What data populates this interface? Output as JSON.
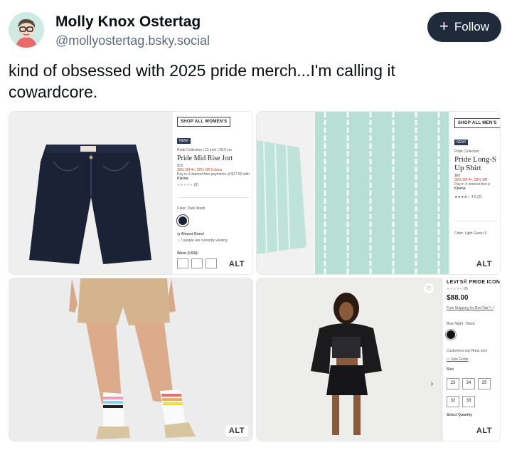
{
  "post": {
    "author_name": "Molly Knox Ostertag",
    "author_handle": "@mollyostertag.bsky.social",
    "follow_label": "Follow",
    "text": "kind of obsessed with 2025 pride merch...I'm calling it cowardcore."
  },
  "images": [
    {
      "alt_badge": "ALT",
      "shop_button": "SHOP ALL WOMEN'S",
      "badge": "NEW!",
      "collection": "Pride Collection | 12 inch | 30.5 cm",
      "title": "Pride Mid Rise Jort",
      "price": "$70",
      "promo": "30% Off 4+, 20% Off 3 items",
      "pay": "Pay in 4 interest-free payments of $17.50 with",
      "klarna": "Klarna",
      "reviews": "(0)",
      "color_label": "Color: Dark Wash",
      "almost_gone": "Almost Gone!",
      "viewing": "7 people are currently viewing",
      "waist": "Waist (USA):"
    },
    {
      "alt_badge": "ALT",
      "shop_button": "SHOP ALL MEN'S",
      "badge": "NEW!",
      "collection": "Pride Collection",
      "title_line1": "Pride Long-S",
      "title_line2": "Up Shirt",
      "price": "$60",
      "promo": "30% Off 4+, 20% Off",
      "pay": "Pay in 4 interest-free p",
      "klarna": "Klarna",
      "rating": "4.5 (2)",
      "color_label": "Color: Light Green S"
    },
    {
      "alt_badge": "ALT"
    },
    {
      "alt_badge": "ALT",
      "title": "LEVI'S® PRIDE ICON",
      "reviews": "(0)",
      "price": "$88.00",
      "shipping": "Free Shipping for Red Tab™ I",
      "color_name": "Blue Night - Black",
      "customers": "Customers say Runs som",
      "size_guide": "Size Guide",
      "size_label": "Size",
      "sizes": [
        "23",
        "24",
        "25",
        "32",
        "33"
      ],
      "quantity": "Select Quantity"
    }
  ],
  "colors": {
    "follow_bg": "#1f2b3a",
    "denim": "#1c2236",
    "mint": "#b8dfd4",
    "khaki": "#d4b48c"
  }
}
